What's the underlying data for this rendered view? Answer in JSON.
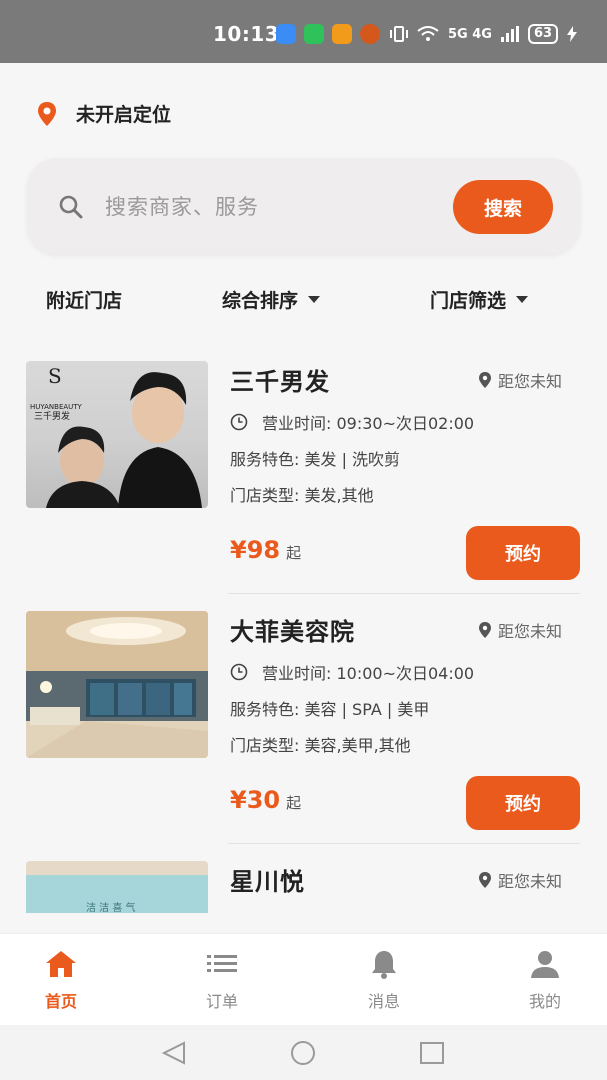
{
  "status_bar": {
    "time": "10:13",
    "network": "5G 4G",
    "battery": "63"
  },
  "location": {
    "text": "未开启定位",
    "accent": "#ea5a1c"
  },
  "search": {
    "placeholder": "搜索商家、服务",
    "button_label": "搜索"
  },
  "filters": {
    "nearby": "附近门店",
    "sort": "综合排序",
    "filter": "门店筛选"
  },
  "stores": [
    {
      "name": "三千男发",
      "distance": "距您未知",
      "hours": "营业时间:  09:30~次日02:00",
      "features": "服务特色:  美发 | 洗吹剪",
      "types": "门店类型:  美发,其他",
      "price": "¥98",
      "price_suffix": "起",
      "book_label": "预约",
      "thumb_text_1": "三千男发",
      "thumb_text_2": "HUYANBEAUTY"
    },
    {
      "name": "大菲美容院",
      "distance": "距您未知",
      "hours": "营业时间:  10:00~次日04:00",
      "features": "服务特色:  美容 | SPA | 美甲",
      "types": "门店类型:  美容,美甲,其他",
      "price": "¥30",
      "price_suffix": "起",
      "book_label": "预约"
    },
    {
      "name": "星川悦",
      "distance": "距您未知",
      "thumb_text": "洁 洁 喜 气"
    }
  ],
  "tabbar": {
    "home": "首页",
    "orders": "订单",
    "messages": "消息",
    "mine": "我的"
  },
  "colors": {
    "accent": "#ea5a1c",
    "inactive": "#8a8a8a"
  }
}
